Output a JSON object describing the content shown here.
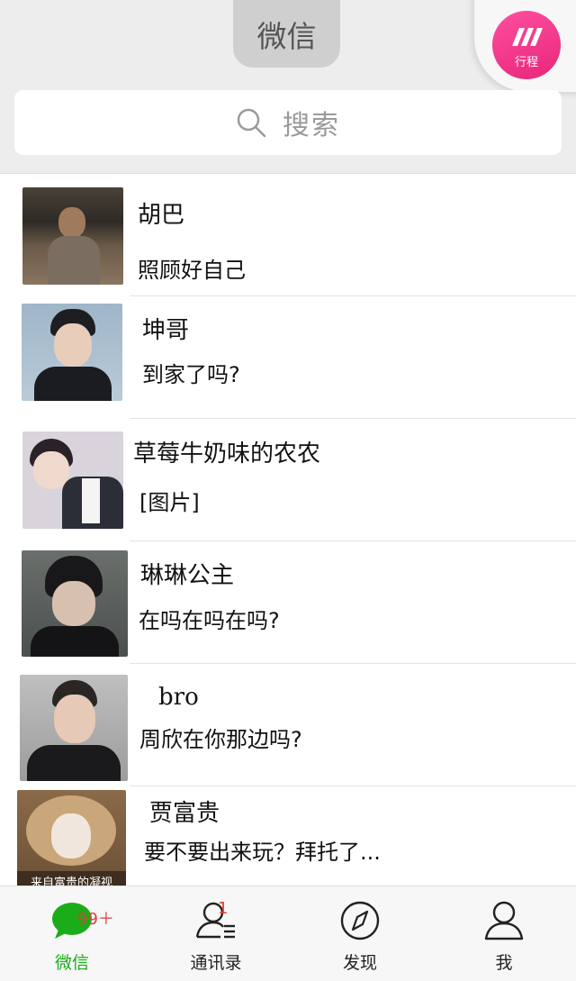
{
  "header": {
    "title": "微信",
    "trip_widget_label": "行程"
  },
  "search": {
    "placeholder": "搜索"
  },
  "chats": [
    {
      "name": "胡巴",
      "message": "照顾好自己"
    },
    {
      "name": "坤哥",
      "message": "到家了吗?"
    },
    {
      "name": "草莓牛奶味的农农",
      "message": "[图片]"
    },
    {
      "name": "琳琳公主",
      "message": "在吗在吗在吗?"
    },
    {
      "name": "bro",
      "message": "周欣在你那边吗?"
    },
    {
      "name": "贾富贵",
      "message": "要不要出来玩？拜托了...",
      "avatar_caption": "来自富贵的凝视"
    }
  ],
  "tabs": [
    {
      "label": "微信",
      "badge": "99＋"
    },
    {
      "label": "通讯录",
      "badge": "1"
    },
    {
      "label": "发现"
    },
    {
      "label": "我"
    }
  ],
  "colors": {
    "accent": "#1aad19",
    "trip_pink": "#f0398a",
    "badge_red": "#e23b3b"
  }
}
